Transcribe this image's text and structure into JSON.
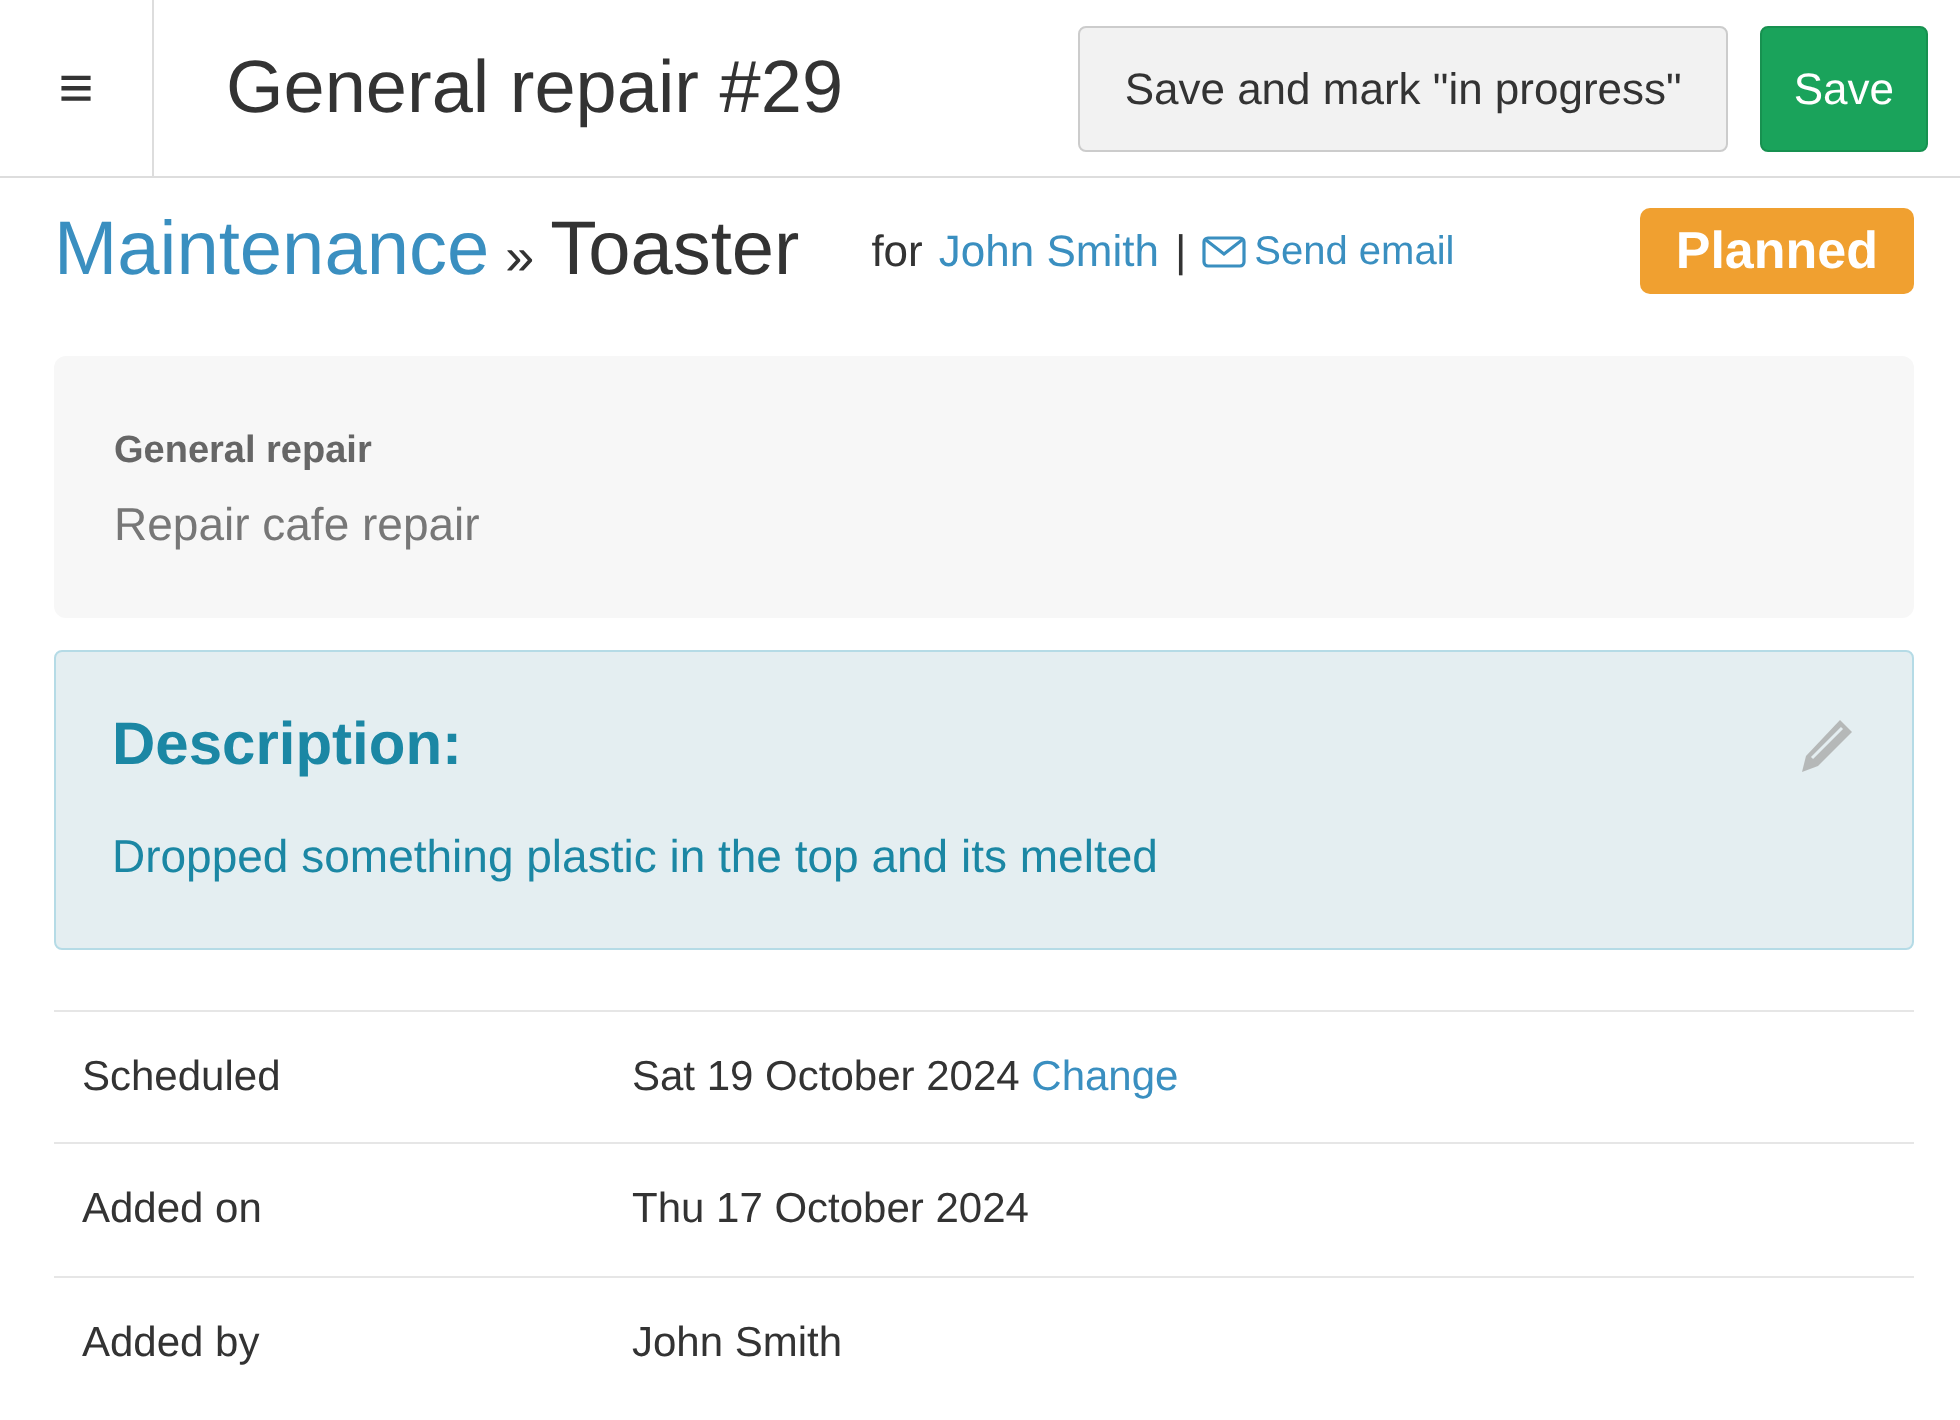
{
  "header": {
    "menu_icon": "≡",
    "title": "General repair #29",
    "buttons": [
      {
        "label": "Save and mark \"in progress\"",
        "kind": "secondary"
      },
      {
        "label": "Save",
        "kind": "primary"
      }
    ]
  },
  "breadcrumb": {
    "parent": "Maintenance",
    "separator": "»",
    "current": "Toaster"
  },
  "customer": {
    "prefix": "for",
    "name": "John Smith",
    "divider": "|",
    "email_link": "Send email"
  },
  "status": "Planned",
  "summary": {
    "title": "General repair",
    "subtitle": "Repair cafe repair"
  },
  "description": {
    "heading": "Description:",
    "text": "Dropped something plastic in the top and its melted"
  },
  "details": [
    {
      "label": "Scheduled",
      "value": "Sat 19 October 2024",
      "action": "Change"
    },
    {
      "label": "Added on",
      "value": "Thu 17 October 2024"
    },
    {
      "label": "Added by",
      "value": "John Smith"
    }
  ]
}
